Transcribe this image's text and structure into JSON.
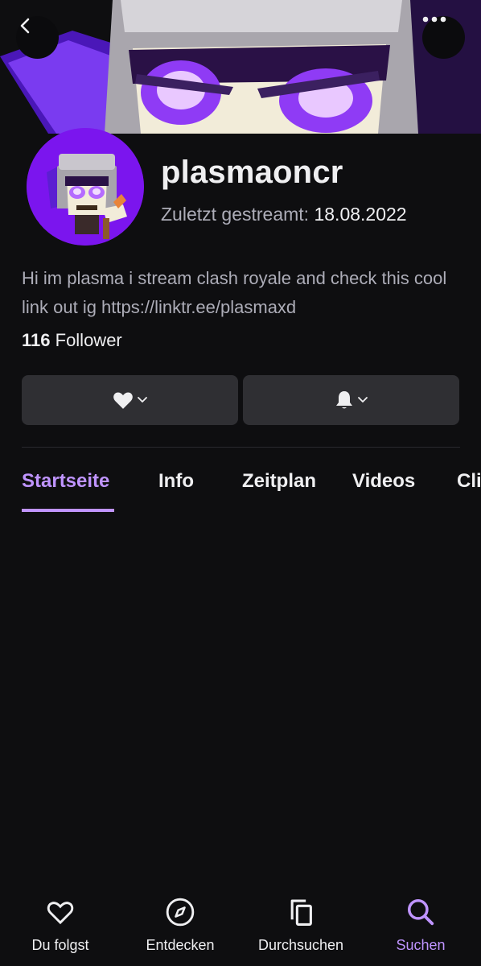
{
  "colors": {
    "background": "#0e0e10",
    "accent": "#bf94ff",
    "button_bg": "#2f2f33",
    "avatar_bg": "#7b15ee",
    "text_primary": "#efeff1",
    "text_secondary": "#adadb8"
  },
  "header": {
    "back_icon": "chevron-left-icon",
    "more_icon": "more-horizontal-icon"
  },
  "channel": {
    "name": "plasmaoncr",
    "last_streamed_label": "Zuletzt gestreamt:",
    "last_streamed_date": "18.08.2022",
    "bio": "Hi im plasma i stream clash royale and check this cool link out ig https://linktr.ee/plasmaxd",
    "follower_count": "116",
    "follower_label": "Follower"
  },
  "actions": {
    "follow_icon": "heart-icon",
    "notify_icon": "bell-icon"
  },
  "tabs": [
    {
      "label": "Startseite",
      "active": true
    },
    {
      "label": "Info"
    },
    {
      "label": "Zeitplan"
    },
    {
      "label": "Videos"
    },
    {
      "label": "Cli"
    }
  ],
  "bottom_nav": [
    {
      "label": "Du folgst",
      "icon": "heart-icon"
    },
    {
      "label": "Entdecken",
      "icon": "compass-icon"
    },
    {
      "label": "Durchsuchen",
      "icon": "copy-icon"
    },
    {
      "label": "Suchen",
      "icon": "search-icon",
      "active": true
    }
  ]
}
